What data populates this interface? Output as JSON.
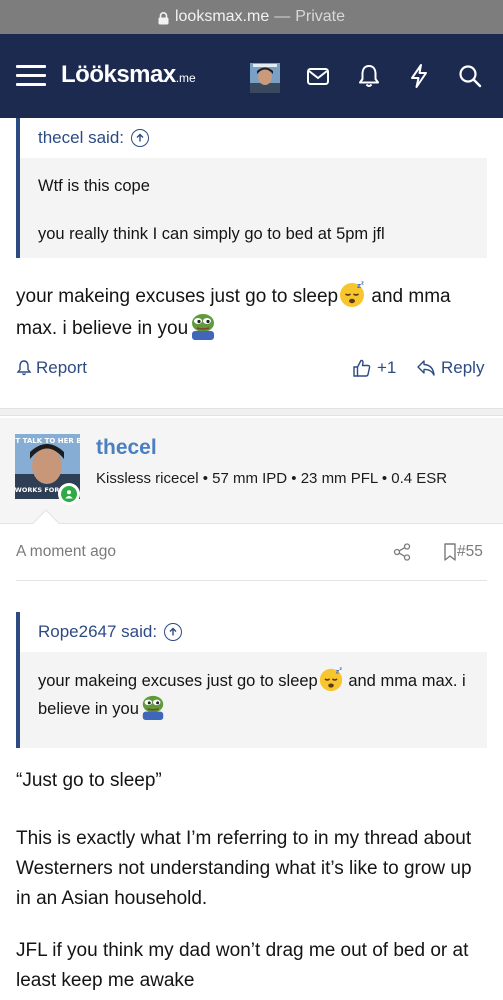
{
  "browser": {
    "domain": "looksmax.me",
    "separator": "—",
    "mode": "Private"
  },
  "header": {
    "logo": "Lööksmax",
    "logo_tld": ".me",
    "icons": [
      "menu-icon",
      "avatar",
      "mail-icon",
      "bell-icon",
      "bolt-icon",
      "search-icon"
    ]
  },
  "post1": {
    "quote": {
      "author_label": "thecel said:",
      "lines": [
        "Wtf is this cope",
        "you really think I can simply go to bed at 5pm jfl"
      ]
    },
    "text_part1": "your makeing excuses just go to sleep",
    "text_part2": " and mma max. i believe in you",
    "actions": {
      "report": "Report",
      "like": "+1",
      "reply": "Reply"
    }
  },
  "post2": {
    "user": {
      "name": "thecel",
      "meta": "Kissless ricecel • 57 mm IPD • 23 mm PFL • 0.4 ESR",
      "avatar_caption_top": "JUST TALK TO HER BRO",
      "avatar_caption_bottom": "WORKS FOR"
    },
    "time": "A moment ago",
    "number": "#55",
    "quote": {
      "author_label": "Rope2647 said:",
      "text_part1": "your makeing excuses just go to sleep",
      "text_part2": " and mma max. i believe in you"
    },
    "paragraphs": [
      "“Just go to sleep”",
      "This is exactly what I’m referring to in my thread about Westerners not understanding what it’s like to grow up in an Asian household.",
      "JFL if you think my dad won’t drag me out of bed or at least keep me awake"
    ]
  },
  "colors": {
    "header_bg": "#1b2a4e",
    "link": "#2d4b83",
    "username": "#4c7fc0",
    "online": "#2fab45"
  }
}
